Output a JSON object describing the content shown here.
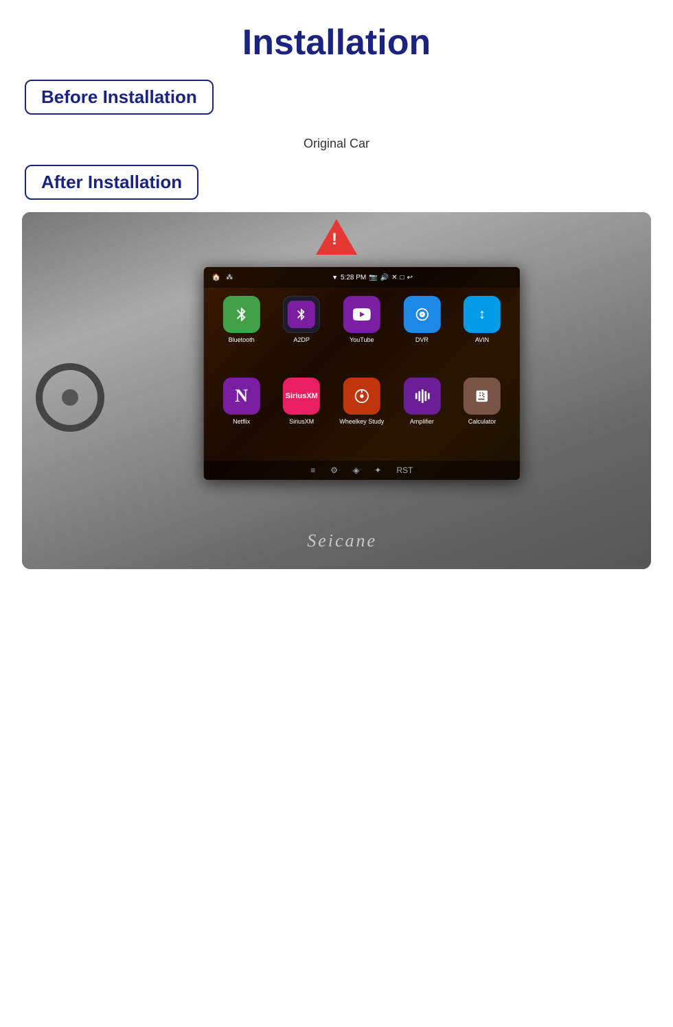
{
  "page": {
    "title": "Installation"
  },
  "before_section": {
    "badge_text": "Before Installation",
    "caption": "Original Car"
  },
  "after_section": {
    "badge_text": "After Installation"
  },
  "screen": {
    "status_time": "5:28 PM",
    "apps": [
      {
        "id": "bluetooth",
        "label": "Bluetooth",
        "color": "bluetooth",
        "icon": "⚡"
      },
      {
        "id": "a2dp",
        "label": "A2DP",
        "color": "a2dp",
        "icon": "✦"
      },
      {
        "id": "youtube",
        "label": "YouTube",
        "color": "youtube",
        "icon": "▶"
      },
      {
        "id": "dvr",
        "label": "DVR",
        "color": "dvr",
        "icon": "◎"
      },
      {
        "id": "avin",
        "label": "AVIN",
        "color": "avin",
        "icon": "↕"
      },
      {
        "id": "netflix",
        "label": "Netflix",
        "color": "netflix",
        "icon": "N"
      },
      {
        "id": "siriusxm",
        "label": "SiriusXM",
        "color": "siriusxm",
        "icon": "◉"
      },
      {
        "id": "wheelkey",
        "label": "Wheelkey Study",
        "color": "wheelkey",
        "icon": "⊕"
      },
      {
        "id": "amplifier",
        "label": "Amplifier",
        "color": "amplifier",
        "icon": "⠿"
      },
      {
        "id": "calculator",
        "label": "Calculator",
        "color": "calculator",
        "icon": "⊞"
      }
    ],
    "brand": "Seicane"
  }
}
